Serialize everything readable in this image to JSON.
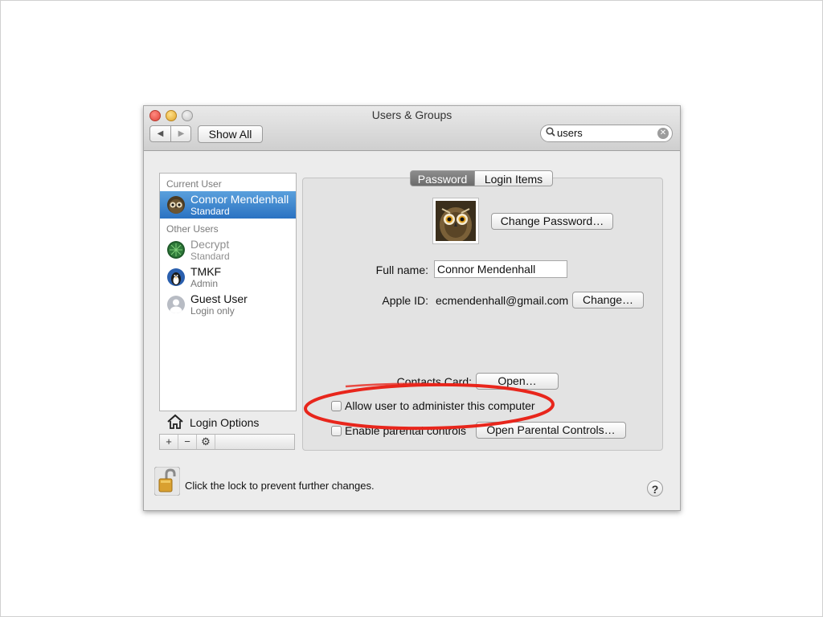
{
  "window": {
    "title": "Users & Groups",
    "nav_back": "◀",
    "nav_forward": "▶",
    "show_all": "Show All",
    "search": {
      "value": "users",
      "icon": "magnifier-icon",
      "clear_icon": "clear-icon"
    }
  },
  "sidebar": {
    "current_user_header": "Current User",
    "other_users_header": "Other Users",
    "current_user": {
      "name": "Connor Mendenhall",
      "role": "Standard",
      "selected": true
    },
    "other_users": [
      {
        "name": "Decrypt",
        "role": "Standard"
      },
      {
        "name": "TMKF",
        "role": "Admin"
      },
      {
        "name": "Guest User",
        "role": "Login only"
      }
    ],
    "login_options": "Login Options",
    "tools": [
      "+",
      "−",
      "⚙"
    ]
  },
  "tabs": [
    {
      "label": "Password",
      "active": true
    },
    {
      "label": "Login Items",
      "active": false
    }
  ],
  "password_pane": {
    "change_password": "Change Password…",
    "full_name_label": "Full name:",
    "full_name_value": "Connor Mendenhall",
    "apple_id_label": "Apple ID:",
    "apple_id_value": "ecmendenhall@gmail.com",
    "apple_id_change": "Change…",
    "contacts_card_label": "Contacts Card:",
    "contacts_open": "Open…",
    "allow_admin": {
      "label": "Allow user to administer this computer",
      "checked": false
    },
    "parental_controls": {
      "label": "Enable parental controls",
      "checked": false
    },
    "open_parental_controls": "Open Parental Controls…"
  },
  "footer": {
    "lock_text": "Click the lock to prevent further changes.",
    "help": "?"
  },
  "colors": {
    "selection": "#2a72c2",
    "annotation": "#e8261c",
    "lock_gold": "#d9a030"
  }
}
